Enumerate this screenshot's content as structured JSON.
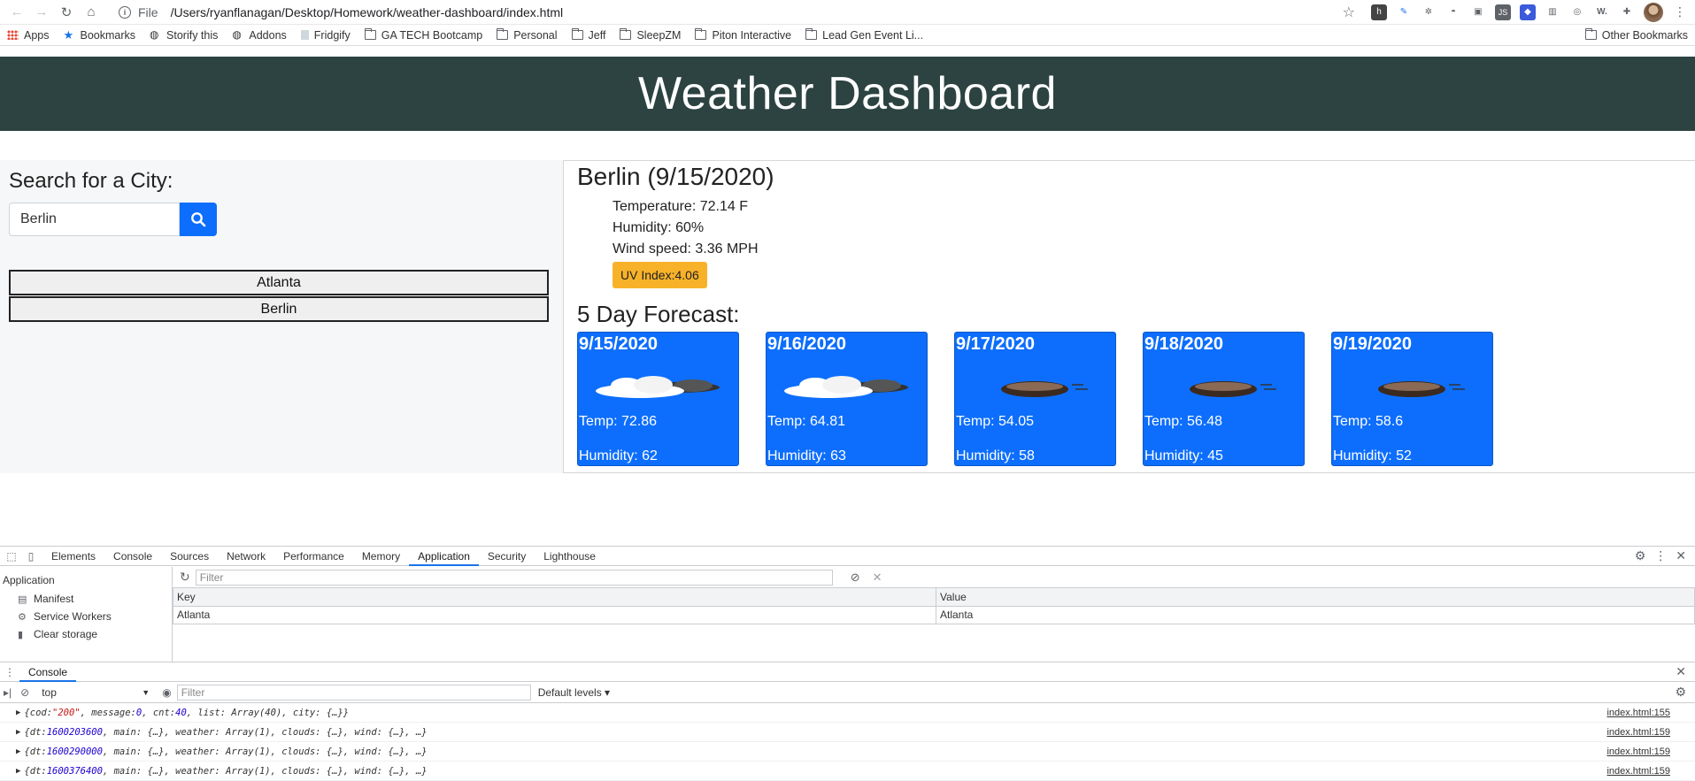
{
  "browser": {
    "scheme": "File",
    "url": "/Users/ryanflanagan/Desktop/Homework/weather-dashboard/index.html"
  },
  "bookmarks": {
    "items": [
      "Apps",
      "Bookmarks",
      "Storify this",
      "Addons",
      "Fridgify",
      "GA TECH Bootcamp",
      "Personal",
      "Jeff",
      "SleepZM",
      "Piton Interactive",
      "Lead Gen Event Li..."
    ],
    "other": "Other Bookmarks"
  },
  "page": {
    "title": "Weather Dashboard",
    "search_heading": "Search for a City:",
    "search_value": "Berlin",
    "history": [
      "Atlanta",
      "Berlin"
    ],
    "current": {
      "title": "Berlin (9/15/2020)",
      "temperature": "Temperature: 72.14 F",
      "humidity": "Humidity: 60%",
      "wind": "Wind speed: 3.36 MPH",
      "uv": "UV Index:4.06"
    },
    "forecast_title": "5 Day Forecast:",
    "forecast": [
      {
        "date": "9/15/2020",
        "icon": "cloudy-icon",
        "temp": "Temp: 72.86",
        "humidity": "Humidity: 62"
      },
      {
        "date": "9/16/2020",
        "icon": "cloudy-icon",
        "temp": "Temp: 64.81",
        "humidity": "Humidity: 63"
      },
      {
        "date": "9/17/2020",
        "icon": "overcast-icon",
        "temp": "Temp: 54.05",
        "humidity": "Humidity: 58"
      },
      {
        "date": "9/18/2020",
        "icon": "overcast-icon",
        "temp": "Temp: 56.48",
        "humidity": "Humidity: 45"
      },
      {
        "date": "9/19/2020",
        "icon": "overcast-icon",
        "temp": "Temp: 58.6",
        "humidity": "Humidity: 52"
      }
    ],
    "colors": {
      "header": "#2c4341",
      "card": "#0d6efd",
      "uv": "#f8b229"
    }
  },
  "devtools": {
    "tabs": [
      "Elements",
      "Console",
      "Sources",
      "Network",
      "Performance",
      "Memory",
      "Application",
      "Security",
      "Lighthouse"
    ],
    "active_tab": "Application",
    "sidebar": {
      "heading": "Application",
      "items": [
        "Manifest",
        "Service Workers",
        "Clear storage"
      ]
    },
    "filter_placeholder": "Filter",
    "table": {
      "headers": [
        "Key",
        "Value"
      ],
      "rows": [
        [
          "Atlanta",
          "Atlanta"
        ]
      ]
    },
    "drawer": {
      "tab": "Console",
      "context": "top",
      "filter_placeholder": "Filter",
      "levels": "Default levels ▾",
      "logs": [
        {
          "text_parts": [
            "{cod: ",
            "\"200\"",
            ", message: ",
            "0",
            ", cnt: ",
            "40",
            ", list: Array(40), city: {…}}"
          ],
          "src": "index.html:155"
        },
        {
          "text_parts": [
            "{dt: ",
            "1600203600",
            ", main: {…}, weather: Array(1), clouds: {…}, wind: {…}, …}"
          ],
          "src": "index.html:159"
        },
        {
          "text_parts": [
            "{dt: ",
            "1600290000",
            ", main: {…}, weather: Array(1), clouds: {…}, wind: {…}, …}"
          ],
          "src": "index.html:159"
        },
        {
          "text_parts": [
            "{dt: ",
            "1600376400",
            ", main: {…}, weather: Array(1), clouds: {…}, wind: {…}, …}"
          ],
          "src": "index.html:159"
        }
      ]
    }
  }
}
